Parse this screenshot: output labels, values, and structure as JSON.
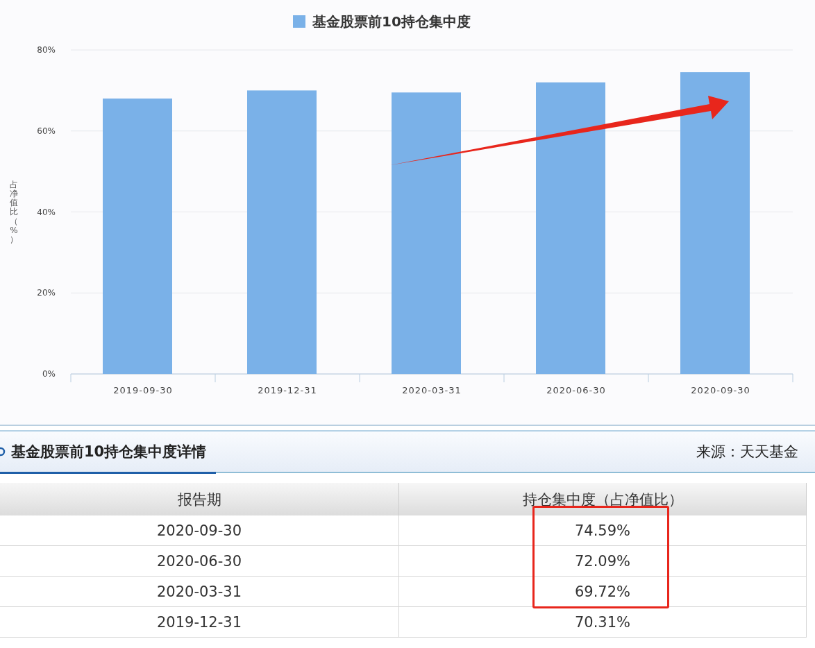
{
  "chart_data": {
    "type": "bar",
    "grid": true,
    "ylabel": "占净值比（%）",
    "categories": [
      "2019-09-30",
      "2019-12-31",
      "2020-03-31",
      "2020-06-30",
      "2020-09-30"
    ],
    "series": [
      {
        "name": "基金股票前10持仓集中度",
        "color": "#7ab1e8",
        "values": [
          68,
          70,
          69.5,
          72,
          74.5
        ]
      }
    ],
    "ylim": [
      0,
      80
    ],
    "yticks": [
      {
        "value": 0,
        "label": "0%"
      },
      {
        "value": 20,
        "label": "20%"
      },
      {
        "value": 40,
        "label": "40%"
      },
      {
        "value": 60,
        "label": "60%"
      },
      {
        "value": 80,
        "label": "80%"
      }
    ]
  },
  "trend_arrow": true,
  "section": {
    "title": "基金股票前10持仓集中度详情",
    "source": "来源：天天基金"
  },
  "table": {
    "columns": [
      "报告期",
      "持仓集中度（占净值比）"
    ],
    "rows": [
      {
        "cells": [
          "2020-09-30",
          "74.59%"
        ],
        "highlighted": true
      },
      {
        "cells": [
          "2020-06-30",
          "72.09%"
        ],
        "highlighted": true
      },
      {
        "cells": [
          "2020-03-31",
          "69.72%"
        ],
        "highlighted": true
      },
      {
        "cells": [
          "2019-12-31",
          "70.31%"
        ],
        "highlighted": false
      }
    ]
  }
}
